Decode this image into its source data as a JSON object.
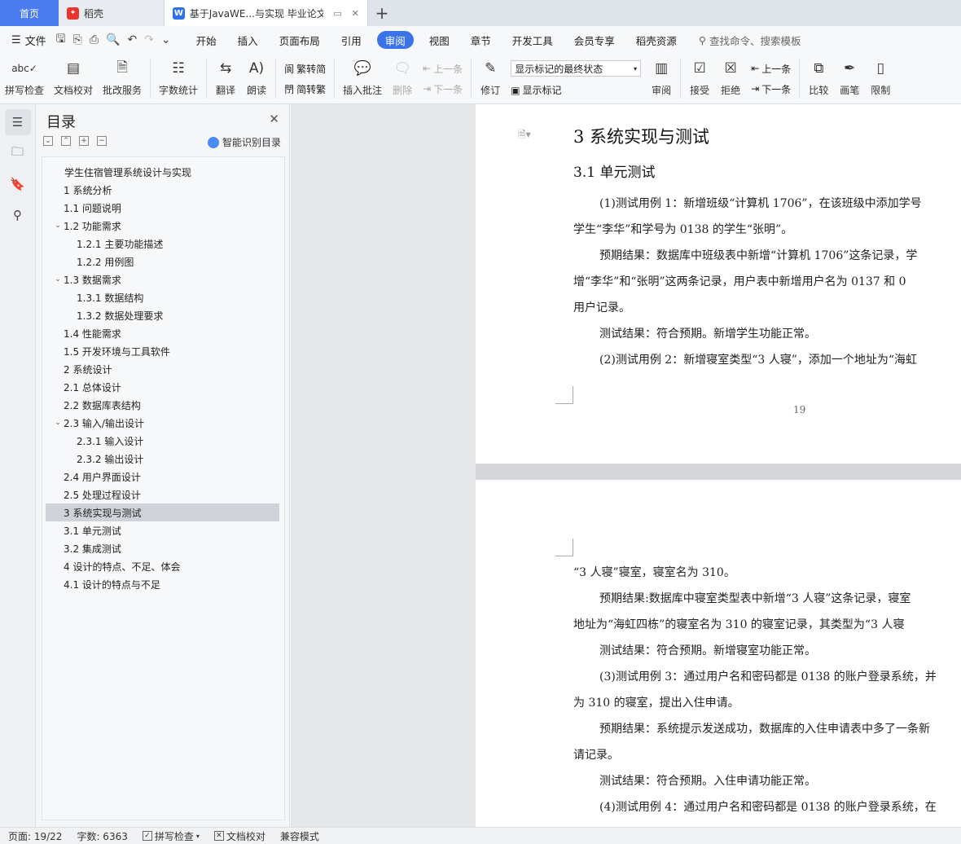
{
  "tabs": {
    "home": "首页",
    "daoke": "稻壳",
    "document": "基于JavaWE...与实现 毕业论文"
  },
  "menu": {
    "file": "文件",
    "tabs": [
      "开始",
      "插入",
      "页面布局",
      "引用",
      "审阅",
      "视图",
      "章节",
      "开发工具",
      "会员专享",
      "稻壳资源"
    ],
    "active_tab": "审阅",
    "search": "查找命令、搜索模板"
  },
  "ribbon": {
    "spell_check": "拼写检查",
    "doc_proof": "文档校对",
    "review_service": "批改服务",
    "word_count": "字数统计",
    "translate": "翻译",
    "read_aloud": "朗读",
    "trad_to_simp": "繁转简",
    "simp_to_trad": "简转繁",
    "insert_comment": "插入批注",
    "delete": "删除",
    "prev_comment": "上一条",
    "next_comment": "下一条",
    "track_changes": "修订",
    "markup_mode": "显示标记的最终状态",
    "show_markup": "显示标记",
    "review": "审阅",
    "accept": "接受",
    "reject": "拒绝",
    "prev_change": "上一条",
    "next_change": "下一条",
    "compare": "比较",
    "ink": "画笔",
    "restrict": "限制"
  },
  "toc": {
    "title": "目录",
    "smart_label": "智能识别目录",
    "items": [
      {
        "label": "学生住宿管理系统设计与实现",
        "level": 0,
        "caret": ""
      },
      {
        "label": "1 系统分析",
        "level": 1,
        "caret": ""
      },
      {
        "label": "1.1 问题说明",
        "level": 1,
        "caret": ""
      },
      {
        "label": "1.2 功能需求",
        "level": 1,
        "caret": "v"
      },
      {
        "label": "1.2.1 主要功能描述",
        "level": 2,
        "caret": ""
      },
      {
        "label": "1.2.2 用例图",
        "level": 2,
        "caret": ""
      },
      {
        "label": "1.3 数据需求",
        "level": 1,
        "caret": "v"
      },
      {
        "label": "1.3.1 数据结构",
        "level": 2,
        "caret": ""
      },
      {
        "label": "1.3.2 数据处理要求",
        "level": 2,
        "caret": ""
      },
      {
        "label": "1.4 性能需求",
        "level": 1,
        "caret": ""
      },
      {
        "label": "1.5 开发环境与工具软件",
        "level": 1,
        "caret": ""
      },
      {
        "label": "2 系统设计",
        "level": 1,
        "caret": ""
      },
      {
        "label": "2.1 总体设计",
        "level": 1,
        "caret": ""
      },
      {
        "label": "2.2 数据库表结构",
        "level": 1,
        "caret": ""
      },
      {
        "label": "2.3 输入/输出设计",
        "level": 1,
        "caret": "v"
      },
      {
        "label": "2.3.1 输入设计",
        "level": 2,
        "caret": ""
      },
      {
        "label": "2.3.2 输出设计",
        "level": 2,
        "caret": ""
      },
      {
        "label": "2.4 用户界面设计",
        "level": 1,
        "caret": ""
      },
      {
        "label": "2.5 处理过程设计",
        "level": 1,
        "caret": ""
      },
      {
        "label": "3 系统实现与测试",
        "level": 1,
        "caret": "",
        "selected": true
      },
      {
        "label": "3.1 单元测试",
        "level": 1,
        "caret": ""
      },
      {
        "label": "3.2 集成测试",
        "level": 1,
        "caret": ""
      },
      {
        "label": "4 设计的特点、不足、体会",
        "level": 1,
        "caret": ""
      },
      {
        "label": "4.1 设计的特点与不足",
        "level": 1,
        "caret": ""
      }
    ]
  },
  "document": {
    "page1": {
      "heading1": "3 系统实现与测试",
      "heading2": "3.1 单元测试",
      "lines": [
        {
          "text": "(1)测试用例 1：新增班级“计算机 1706”，在该班级中添加学号",
          "indent": true
        },
        {
          "text": "学生“李华”和学号为 0138 的学生“张明”。",
          "indent": false
        },
        {
          "text": "预期结果：数据库中班级表中新增“计算机 1706”这条记录，学",
          "indent": true
        },
        {
          "text": "增“李华”和“张明”这两条记录，用户表中新增用户名为 0137 和 0",
          "indent": false
        },
        {
          "text": "用户记录。",
          "indent": false
        },
        {
          "text": "测试结果：符合预期。新增学生功能正常。",
          "indent": true
        },
        {
          "text": "(2)测试用例 2：新增寝室类型“3 人寝”，添加一个地址为“海虹",
          "indent": true
        }
      ],
      "page_number": "19"
    },
    "page2": {
      "lines": [
        {
          "text": "“3 人寝”寝室，寝室名为 310。",
          "indent": false
        },
        {
          "text": "预期结果:数据库中寝室类型表中新增“3 人寝”这条记录，寝室",
          "indent": true
        },
        {
          "text": "地址为“海虹四栋”的寝室名为 310 的寝室记录，其类型为“3 人寝",
          "indent": false
        },
        {
          "text": "测试结果：符合预期。新增寝室功能正常。",
          "indent": true
        },
        {
          "text": "(3)测试用例 3：通过用户名和密码都是 0138 的账户登录系统，并",
          "indent": true
        },
        {
          "text": "为 310 的寝室，提出入住申请。",
          "indent": false
        },
        {
          "text": "预期结果：系统提示发送成功，数据库的入住申请表中多了一条新",
          "indent": true
        },
        {
          "text": "请记录。",
          "indent": false
        },
        {
          "text": "测试结果：符合预期。入住申请功能正常。",
          "indent": true
        },
        {
          "text": "(4)测试用例 4：通过用户名和密码都是 0138 的账户登录系统，在",
          "indent": true
        }
      ]
    }
  },
  "status": {
    "page": "页面: 19/22",
    "words": "字数: 6363",
    "spell": "拼写检查",
    "proof": "文档校对",
    "compat": "兼容模式"
  },
  "colors": {
    "accent": "#3a74e8",
    "home_tab": "#4a7cf0",
    "selected_toc": "#cfd3d9"
  }
}
